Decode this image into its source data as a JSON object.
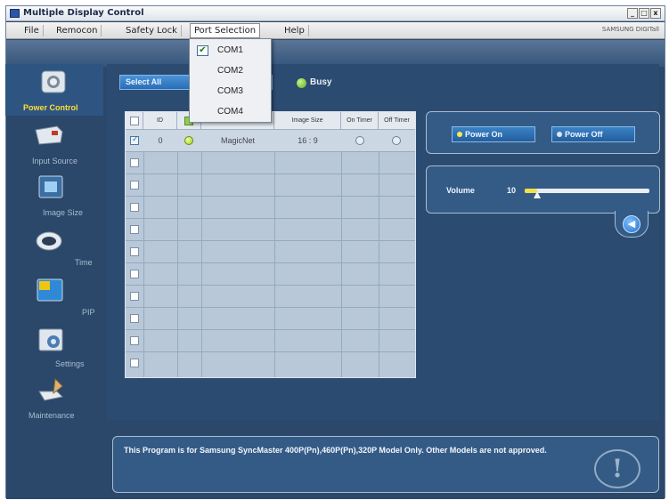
{
  "window": {
    "title": "Multiple Display Control",
    "min": "_",
    "max": "□",
    "close": "x"
  },
  "menubar": {
    "items": [
      "File",
      "Remocon",
      "Safety Lock",
      "Port Selection",
      "Help"
    ],
    "brand": "SAMSUNG DIGITall"
  },
  "port_menu": {
    "options": [
      "COM1",
      "COM2",
      "COM3",
      "COM4"
    ],
    "checked": "COM1",
    "check_mark": "✔"
  },
  "sidebar": {
    "items": [
      {
        "label": "Power Control",
        "icon": "power-control-icon",
        "active": true
      },
      {
        "label": "Input Source",
        "icon": "input-source-icon",
        "active": false
      },
      {
        "label": "Image Size",
        "icon": "image-size-icon",
        "active": false
      },
      {
        "label": "Time",
        "icon": "time-icon",
        "active": false
      },
      {
        "label": "PIP",
        "icon": "pip-icon",
        "active": false
      },
      {
        "label": "Settings",
        "icon": "settings-icon",
        "active": false
      },
      {
        "label": "Maintenance",
        "icon": "maintenance-icon",
        "active": false
      }
    ]
  },
  "toolbar": {
    "select_all": "Select All",
    "busy_label": "Busy"
  },
  "grid": {
    "headers": [
      "",
      "ID",
      "",
      "",
      "Image Size",
      "On Timer",
      "Off Timer"
    ],
    "first_row": {
      "id": "0",
      "name": "MagicNet",
      "image_size": "16 : 9"
    }
  },
  "power": {
    "on_label": "Power On",
    "off_label": "Power Off"
  },
  "volume": {
    "label": "Volume",
    "value": "10",
    "level": 0.1
  },
  "message": {
    "text": "This Program is for Samsung SyncMaster 400P(Pn),460P(Pn),320P  Model Only. Other Models are not approved."
  },
  "colors": {
    "accent": "#ffde33",
    "busy": "#5ab021",
    "panel": "#345b86"
  }
}
